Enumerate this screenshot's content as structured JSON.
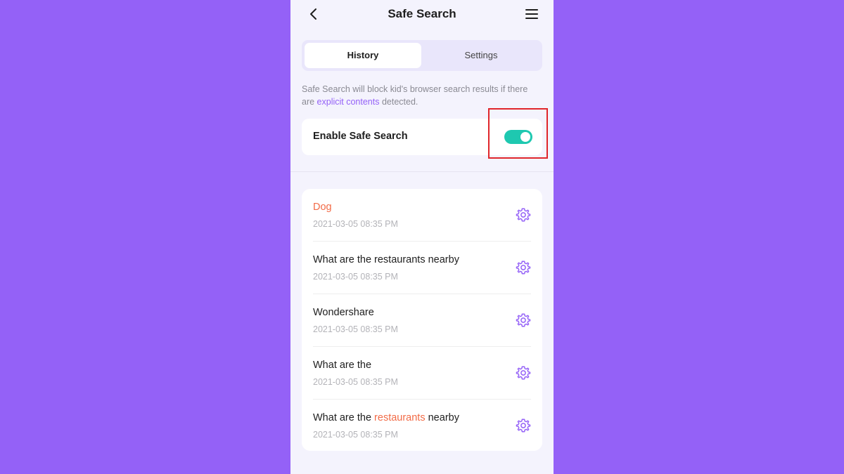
{
  "header": {
    "title": "Safe Search",
    "back_icon": "chevron-left-icon",
    "menu_icon": "hamburger-menu-icon"
  },
  "tabs": [
    {
      "label": "History",
      "active": true
    },
    {
      "label": "Settings",
      "active": false
    }
  ],
  "description": {
    "before": "Safe Search will block kid's browser search results if there are ",
    "link": "explicit contents",
    "after": " detected."
  },
  "toggle": {
    "label": "Enable Safe Search",
    "enabled": true
  },
  "history": [
    {
      "title": "Dog",
      "time": "2021-03-05 08:35 PM"
    },
    {
      "title": "What are the restaurants nearby",
      "time": "2021-03-05 08:35 PM"
    },
    {
      "title": "Wondershare",
      "time": "2021-03-05 08:35 PM"
    },
    {
      "title": "What are the",
      "time": "2021-03-05 08:35 PM"
    },
    {
      "title_before": "What are the ",
      "title_highlight": "restaurants",
      "title_after": " nearby",
      "time": "2021-03-05 08:35 PM"
    }
  ],
  "colors": {
    "background": "#9461f7",
    "accent": "#9461f7",
    "toggle_on": "#1ec8b0",
    "flagged": "#f26b47",
    "highlight_box": "#e0262a"
  }
}
